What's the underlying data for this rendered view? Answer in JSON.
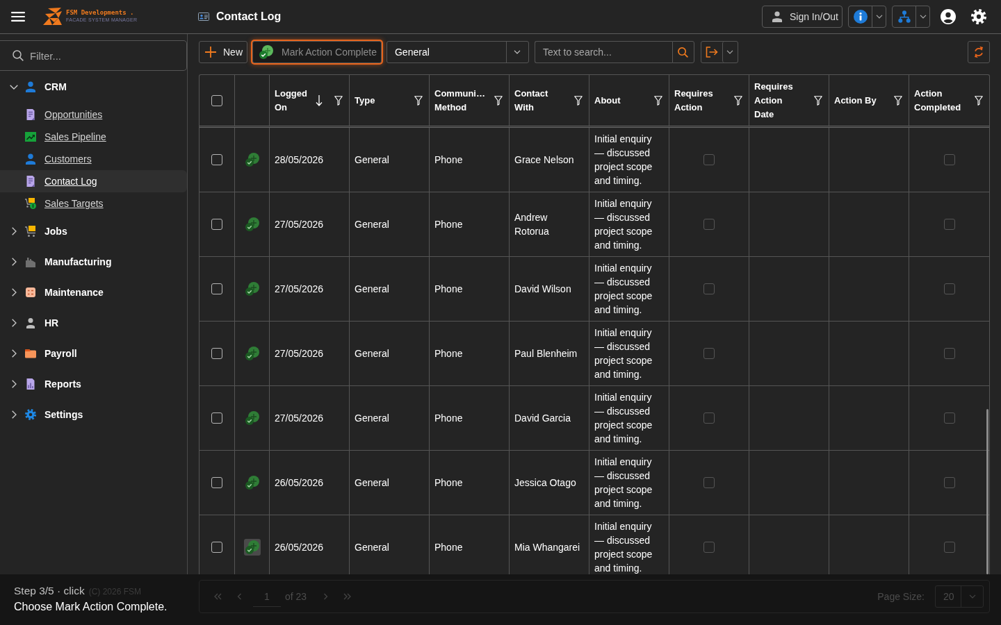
{
  "header": {
    "logo": {
      "name": "FSM Developments .",
      "tagline": "FACADE SYSTEM MANAGER"
    },
    "title": "Contact Log",
    "sign_in": "Sign In/Out"
  },
  "sidebar": {
    "filter": {
      "placeholder": "Filter..."
    },
    "items": [
      {
        "label": "CRM",
        "kind": "person",
        "expanded": true,
        "children": [
          {
            "label": "Opportunities",
            "kind": "notes",
            "selected": false
          },
          {
            "label": "Sales Pipeline",
            "kind": "trend",
            "selected": false
          },
          {
            "label": "Customers",
            "kind": "person",
            "selected": false
          },
          {
            "label": "Contact Log",
            "kind": "notes",
            "selected": true
          },
          {
            "label": "Sales Targets",
            "kind": "target",
            "selected": false
          }
        ]
      },
      {
        "label": "Jobs",
        "kind": "cart",
        "expanded": false
      },
      {
        "label": "Manufacturing",
        "kind": "factory",
        "expanded": false
      },
      {
        "label": "Maintenance",
        "kind": "checklist",
        "expanded": false
      },
      {
        "label": "HR",
        "kind": "user",
        "expanded": false
      },
      {
        "label": "Payroll",
        "kind": "folder",
        "expanded": false
      },
      {
        "label": "Reports",
        "kind": "report",
        "expanded": false
      },
      {
        "label": "Settings",
        "kind": "gear",
        "expanded": false
      }
    ],
    "copyright": "(C) 2026 FSM"
  },
  "toolbar": {
    "new": "New",
    "mark_action": {
      "label": "Mark Action Complete",
      "highlighted": true,
      "disabled": true
    },
    "view": {
      "value": "General"
    },
    "search": {
      "placeholder": "Text to search..."
    }
  },
  "table": {
    "select_all": {
      "checked": false
    },
    "columns": [
      {
        "label": "Logged On",
        "sorted": true
      },
      {
        "label": "Type",
        "sorted": false
      },
      {
        "label": "Communi… Method",
        "sorted": false
      },
      {
        "label": "Contact With",
        "sorted": false
      },
      {
        "label": "About",
        "sorted": false
      },
      {
        "label": "Requires Action",
        "sorted": false
      },
      {
        "label": "Requires Action Date",
        "sorted": false
      },
      {
        "label": "Action By",
        "sorted": false
      },
      {
        "label": "Action Completed",
        "sorted": false
      }
    ],
    "rows": [
      {
        "selected": false,
        "hovered": false,
        "logged_on": "28/05/2026",
        "type": "General",
        "method": "Phone",
        "contact": "Grace Nelson",
        "about": "Initial enquiry — discussed project scope and timing.",
        "requires_action": false,
        "action_completed": false
      },
      {
        "selected": false,
        "hovered": false,
        "logged_on": "27/05/2026",
        "type": "General",
        "method": "Phone",
        "contact": "Andrew Rotorua",
        "about": "Initial enquiry — discussed project scope and timing.",
        "requires_action": false,
        "action_completed": false
      },
      {
        "selected": false,
        "hovered": false,
        "logged_on": "27/05/2026",
        "type": "General",
        "method": "Phone",
        "contact": "David Wilson",
        "about": "Initial enquiry — discussed project scope and timing.",
        "requires_action": false,
        "action_completed": false
      },
      {
        "selected": false,
        "hovered": false,
        "logged_on": "27/05/2026",
        "type": "General",
        "method": "Phone",
        "contact": "Paul Blenheim",
        "about": "Initial enquiry — discussed project scope and timing.",
        "requires_action": false,
        "action_completed": false
      },
      {
        "selected": false,
        "hovered": false,
        "logged_on": "27/05/2026",
        "type": "General",
        "method": "Phone",
        "contact": "David Garcia",
        "about": "Initial enquiry — discussed project scope and timing.",
        "requires_action": false,
        "action_completed": false
      },
      {
        "selected": false,
        "hovered": false,
        "logged_on": "26/05/2026",
        "type": "General",
        "method": "Phone",
        "contact": "Jessica Otago",
        "about": "Initial enquiry — discussed project scope and timing.",
        "requires_action": false,
        "action_completed": false
      },
      {
        "selected": false,
        "hovered": true,
        "logged_on": "26/05/2026",
        "type": "General",
        "method": "Phone",
        "contact": "Mia Whangarei",
        "about": "Initial enquiry — discussed project scope and timing.",
        "requires_action": false,
        "action_completed": false
      }
    ]
  },
  "pager": {
    "page": "1",
    "total": "of 23",
    "page_size_label": "Page Size:",
    "page_size": "20"
  },
  "tutorial": {
    "step": "Step 3/5 · click",
    "instruction": "Choose Mark Action Complete."
  }
}
